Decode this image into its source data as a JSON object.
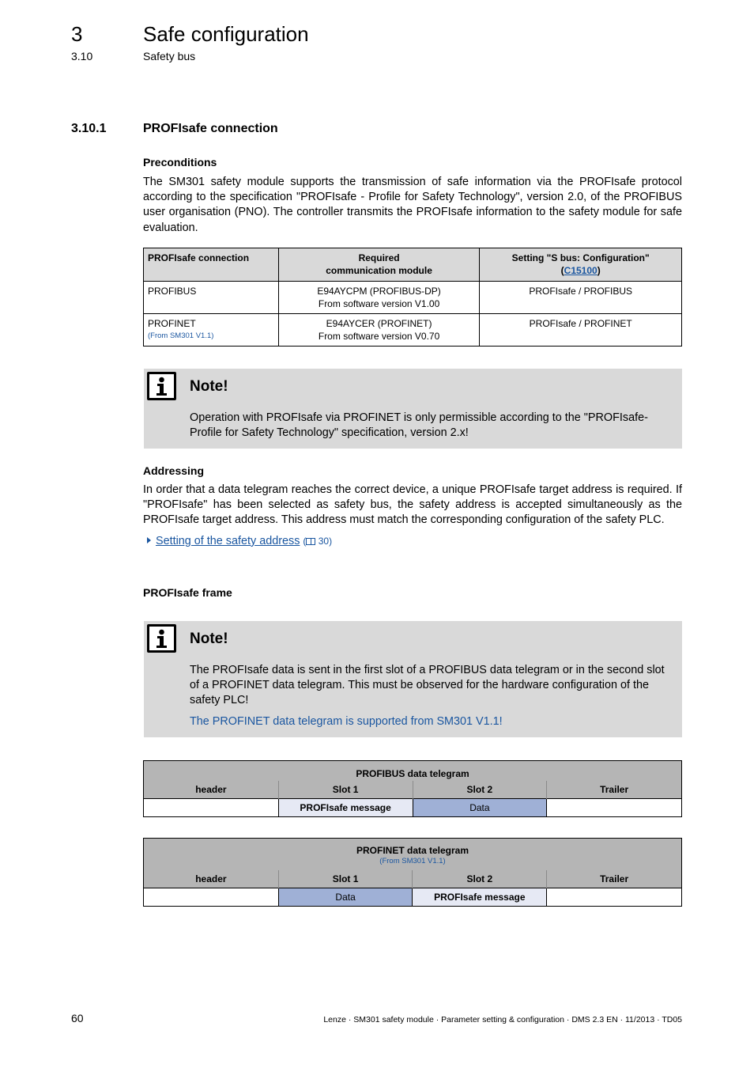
{
  "header": {
    "chapter_number": "3",
    "chapter_title": "Safe configuration",
    "section_number": "3.10",
    "section_title": "Safety bus",
    "separator": "_ _ _ _ _ _ _ _ _ _ _ _ _ _ _ _ _ _ _ _ _ _ _ _ _ _ _ _ _ _ _ _ _ _ _ _ _ _ _ _ _ _ _ _ _ _ _ _ _ _ _ _ _ _ _ _ _ _ _ _ _ _ _ _ _"
  },
  "subsection": {
    "number": "3.10.1",
    "title": "PROFIsafe connection"
  },
  "preconditions": {
    "heading": "Preconditions",
    "text": "The SM301 safety module supports the transmission of safe information via the PROFIsafe protocol according to the specification \"PROFIsafe - Profile for Safety Technology\", version 2.0, of the PROFIBUS user organisation (PNO). The controller transmits the PROFIsafe information to the safety module for safe evaluation."
  },
  "connection_table": {
    "headers": {
      "col1": "PROFIsafe connection",
      "col2_line1": "Required",
      "col2_line2": "communication module",
      "col3_line1": "Setting \"S bus: Configuration\"",
      "col3_paren_open": "(",
      "col3_link": "C15100",
      "col3_paren_close": ")"
    },
    "rows": [
      {
        "connection": "PROFIBUS",
        "note": "",
        "module_line1": "E94AYCPM (PROFIBUS-DP)",
        "module_line2": "From software version V1.00",
        "setting": "PROFIsafe / PROFIBUS"
      },
      {
        "connection": "PROFINET",
        "note": "(From SM301 V1.1)",
        "module_line1": "E94AYCER (PROFINET)",
        "module_line2": "From software version V0.70",
        "setting": "PROFIsafe / PROFINET"
      }
    ]
  },
  "note1": {
    "icon": "info-icon",
    "title": "Note!",
    "text": "Operation with PROFIsafe via PROFINET is only permissible according to the \"PROFIsafe-Profile for Safety Technology\" specification, version 2.x!"
  },
  "addressing": {
    "heading": "Addressing",
    "text": "In order that a data telegram reaches the correct device, a unique PROFIsafe target address is required. If \"PROFIsafe\" has been selected as safety bus, the safety address is accepted simultaneously as the PROFIsafe target address. This address must match the corresponding configuration of the safety PLC.",
    "xref_label": "Setting of the safety address",
    "xref_page_open": "(",
    "xref_page": " 30)"
  },
  "frame": {
    "heading": "PROFIsafe frame"
  },
  "note2": {
    "icon": "info-icon",
    "title": "Note!",
    "text": "The PROFIsafe data is sent in the first slot of a PROFIBUS data telegram or in the second slot of a PROFINET data telegram. This must be observed for the hardware configuration of the safety PLC!",
    "highlight": "The PROFINET data telegram is supported from SM301 V1.1!"
  },
  "profibus_telegram": {
    "title": "PROFIBUS data telegram",
    "subtitle": "",
    "columns": [
      "header",
      "Slot 1",
      "Slot 2",
      "Trailer"
    ],
    "cells": [
      "",
      "PROFIsafe message",
      "Data",
      ""
    ]
  },
  "profinet_telegram": {
    "title": "PROFINET data telegram",
    "subtitle": "(From SM301 V1.1)",
    "columns": [
      "header",
      "Slot 1",
      "Slot 2",
      "Trailer"
    ],
    "cells": [
      "",
      "Data",
      "PROFIsafe message",
      ""
    ]
  },
  "colors": {
    "link_blue": "#1a56a0",
    "note_bg": "#d9d9d9",
    "table_header_bg": "#b5b5b5",
    "profisafe_cell": "#e6e9f4",
    "data_cell": "#9fb0d6"
  },
  "footer": {
    "page_number": "60",
    "doc_info": "Lenze · SM301 safety module · Parameter setting & configuration · DMS 2.3 EN · 11/2013 · TD05"
  }
}
